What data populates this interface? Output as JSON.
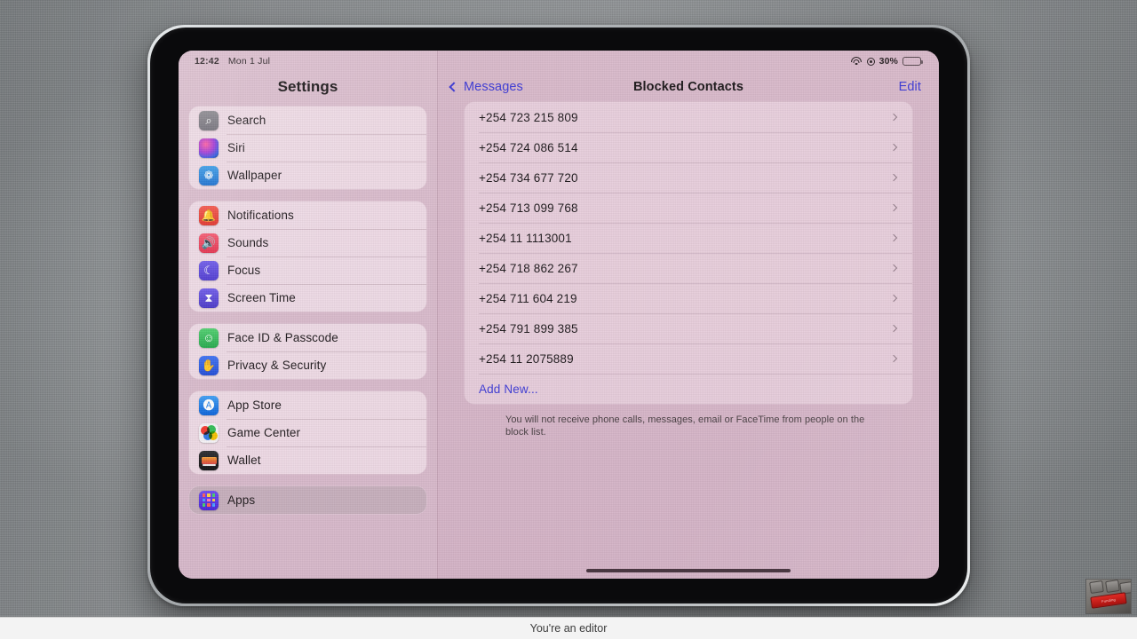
{
  "caption": {
    "text": "You're an editor"
  },
  "thumbnail": {
    "name": "keyboard-red-key-thumbnail",
    "key_label": "Funding"
  },
  "status_bar": {
    "time": "12:42",
    "date": "Mon 1 Jul",
    "wifi_icon": "wifi-icon",
    "record_icon": "record-indicator-icon",
    "battery_percent": "30%",
    "battery_level": 30,
    "battery_icon": "battery-icon"
  },
  "sidebar": {
    "title": "Settings",
    "groups": [
      {
        "items": [
          {
            "label": "Search",
            "icon": "search-icon",
            "selected": false
          },
          {
            "label": "Siri",
            "icon": "siri-icon",
            "selected": false
          },
          {
            "label": "Wallpaper",
            "icon": "wallpaper-icon",
            "selected": false
          }
        ]
      },
      {
        "items": [
          {
            "label": "Notifications",
            "icon": "notifications-icon",
            "selected": false
          },
          {
            "label": "Sounds",
            "icon": "sounds-icon",
            "selected": false
          },
          {
            "label": "Focus",
            "icon": "focus-moon-icon",
            "selected": false
          },
          {
            "label": "Screen Time",
            "icon": "screen-time-icon",
            "selected": false
          }
        ]
      },
      {
        "items": [
          {
            "label": "Face ID & Passcode",
            "icon": "face-id-icon",
            "selected": false
          },
          {
            "label": "Privacy & Security",
            "icon": "privacy-hand-icon",
            "selected": false
          }
        ]
      },
      {
        "items": [
          {
            "label": "App Store",
            "icon": "app-store-icon",
            "selected": false
          },
          {
            "label": "Game Center",
            "icon": "game-center-icon",
            "selected": false
          },
          {
            "label": "Wallet",
            "icon": "wallet-icon",
            "selected": false
          }
        ]
      },
      {
        "items": [
          {
            "label": "Apps",
            "icon": "apps-grid-icon",
            "selected": true
          }
        ]
      }
    ]
  },
  "main": {
    "back_label": "Messages",
    "title": "Blocked Contacts",
    "edit_label": "Edit",
    "rows": [
      {
        "number": "+254 723 215 809"
      },
      {
        "number": "+254 724 086 514"
      },
      {
        "number": "+254 734 677 720"
      },
      {
        "number": "+254 713 099 768"
      },
      {
        "number": "+254 11 1113001"
      },
      {
        "number": "+254 718 862 267"
      },
      {
        "number": "+254 711 604 219"
      },
      {
        "number": "+254 791 899 385"
      },
      {
        "number": "+254 11 2075889"
      }
    ],
    "add_new_label": "Add New...",
    "footer": "You will not receive phone calls, messages, email or FaceTime from people on the block list."
  },
  "colors": {
    "accent_blue": "#3e3bd6",
    "screen_tint": "#d7b7c9",
    "sidebar_tint": "#d9bbcc",
    "bezel": "#0a0a0c"
  }
}
